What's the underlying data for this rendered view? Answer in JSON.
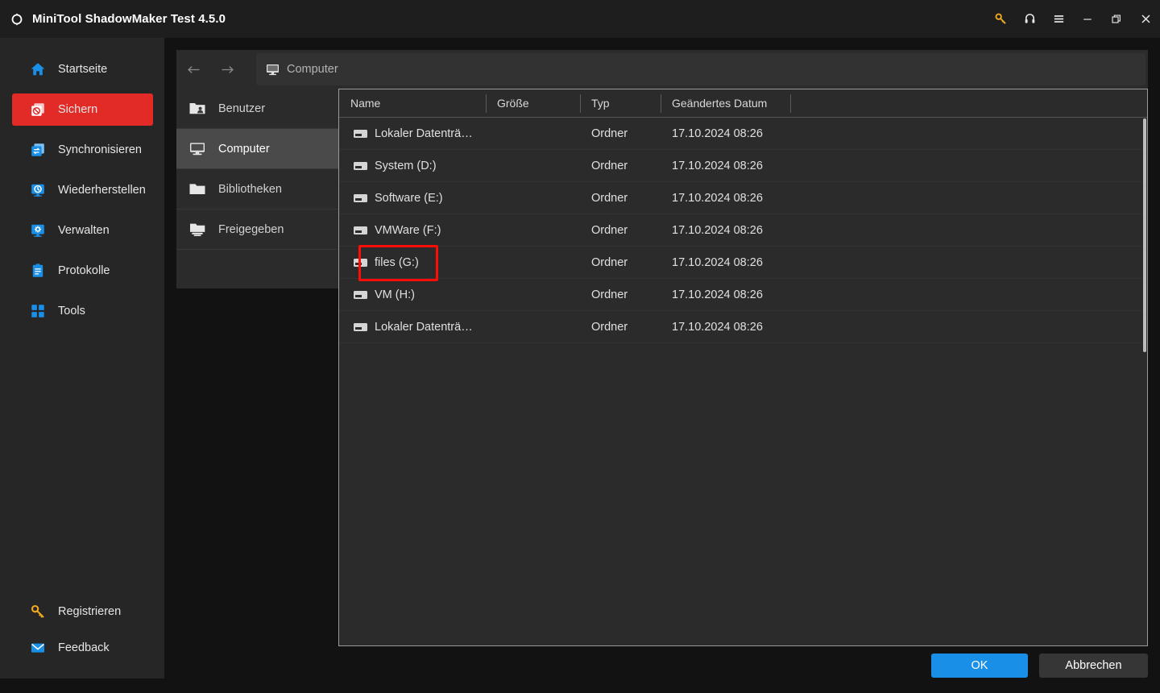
{
  "window": {
    "title": "MiniTool ShadowMaker Test 4.5.0",
    "logo_icon": "minitool-logo-icon",
    "controls": [
      {
        "name": "license-key-icon",
        "glyph": "key",
        "color": "#f0a81e"
      },
      {
        "name": "support-headset-icon",
        "glyph": "headset",
        "color": "#e8e8e8"
      },
      {
        "name": "menu-hamburger-icon",
        "glyph": "hamburger",
        "color": "#e8e8e8"
      },
      {
        "name": "minimize-button-icon",
        "glyph": "minimize",
        "color": "#e8e8e8"
      },
      {
        "name": "restore-button-icon",
        "glyph": "restore",
        "color": "#e8e8e8"
      },
      {
        "name": "close-button-icon",
        "glyph": "close",
        "color": "#e8e8e8"
      }
    ]
  },
  "sidebar": {
    "items": [
      {
        "label": "Startseite",
        "icon": "home-icon",
        "active": false
      },
      {
        "label": "Sichern",
        "icon": "backup-icon",
        "active": true
      },
      {
        "label": "Synchronisieren",
        "icon": "sync-icon",
        "active": false
      },
      {
        "label": "Wiederherstellen",
        "icon": "restore-icon",
        "active": false
      },
      {
        "label": "Verwalten",
        "icon": "manage-icon",
        "active": false
      },
      {
        "label": "Protokolle",
        "icon": "logs-icon",
        "active": false
      },
      {
        "label": "Tools",
        "icon": "tools-icon",
        "active": false
      }
    ],
    "bottom_items": [
      {
        "label": "Registrieren",
        "icon": "key-icon"
      },
      {
        "label": "Feedback",
        "icon": "mail-icon"
      }
    ],
    "active_color": "#e22b26",
    "icon_color": "#1a8fe8"
  },
  "navbar": {
    "back_icon": "arrow-left-icon",
    "forward_icon": "arrow-right-icon",
    "path_icon": "computer-icon",
    "path_value": "Computer"
  },
  "tree": {
    "items": [
      {
        "label": "Benutzer",
        "icon": "users-folder-icon",
        "selected": false
      },
      {
        "label": "Computer",
        "icon": "computer-icon",
        "selected": true
      },
      {
        "label": "Bibliotheken",
        "icon": "folder-icon",
        "selected": false
      },
      {
        "label": "Freigegeben",
        "icon": "shared-folder-icon",
        "selected": false
      }
    ]
  },
  "filelist": {
    "columns": [
      "Name",
      "Größe",
      "Typ",
      "Geändertes Datum"
    ],
    "rows": [
      {
        "name": "Lokaler Datenträ…",
        "size": "",
        "type": "Ordner",
        "date": "17.10.2024 08:26",
        "icon": "drive-icon",
        "highlighted": false
      },
      {
        "name": "System (D:)",
        "size": "",
        "type": "Ordner",
        "date": "17.10.2024 08:26",
        "icon": "drive-icon",
        "highlighted": false
      },
      {
        "name": "Software (E:)",
        "size": "",
        "type": "Ordner",
        "date": "17.10.2024 08:26",
        "icon": "drive-icon",
        "highlighted": false
      },
      {
        "name": "VMWare (F:)",
        "size": "",
        "type": "Ordner",
        "date": "17.10.2024 08:26",
        "icon": "drive-icon",
        "highlighted": false
      },
      {
        "name": "files (G:)",
        "size": "",
        "type": "Ordner",
        "date": "17.10.2024 08:26",
        "icon": "drive-icon",
        "highlighted": true
      },
      {
        "name": "VM (H:)",
        "size": "",
        "type": "Ordner",
        "date": "17.10.2024 08:26",
        "icon": "drive-icon",
        "highlighted": false
      },
      {
        "name": "Lokaler Datenträ…",
        "size": "",
        "type": "Ordner",
        "date": "17.10.2024 08:26",
        "icon": "drive-icon",
        "highlighted": false
      }
    ],
    "annotation_color": "#fd0d08"
  },
  "footer": {
    "ok_label": "OK",
    "cancel_label": "Abbrechen",
    "ok_color": "#1a8fe8"
  }
}
